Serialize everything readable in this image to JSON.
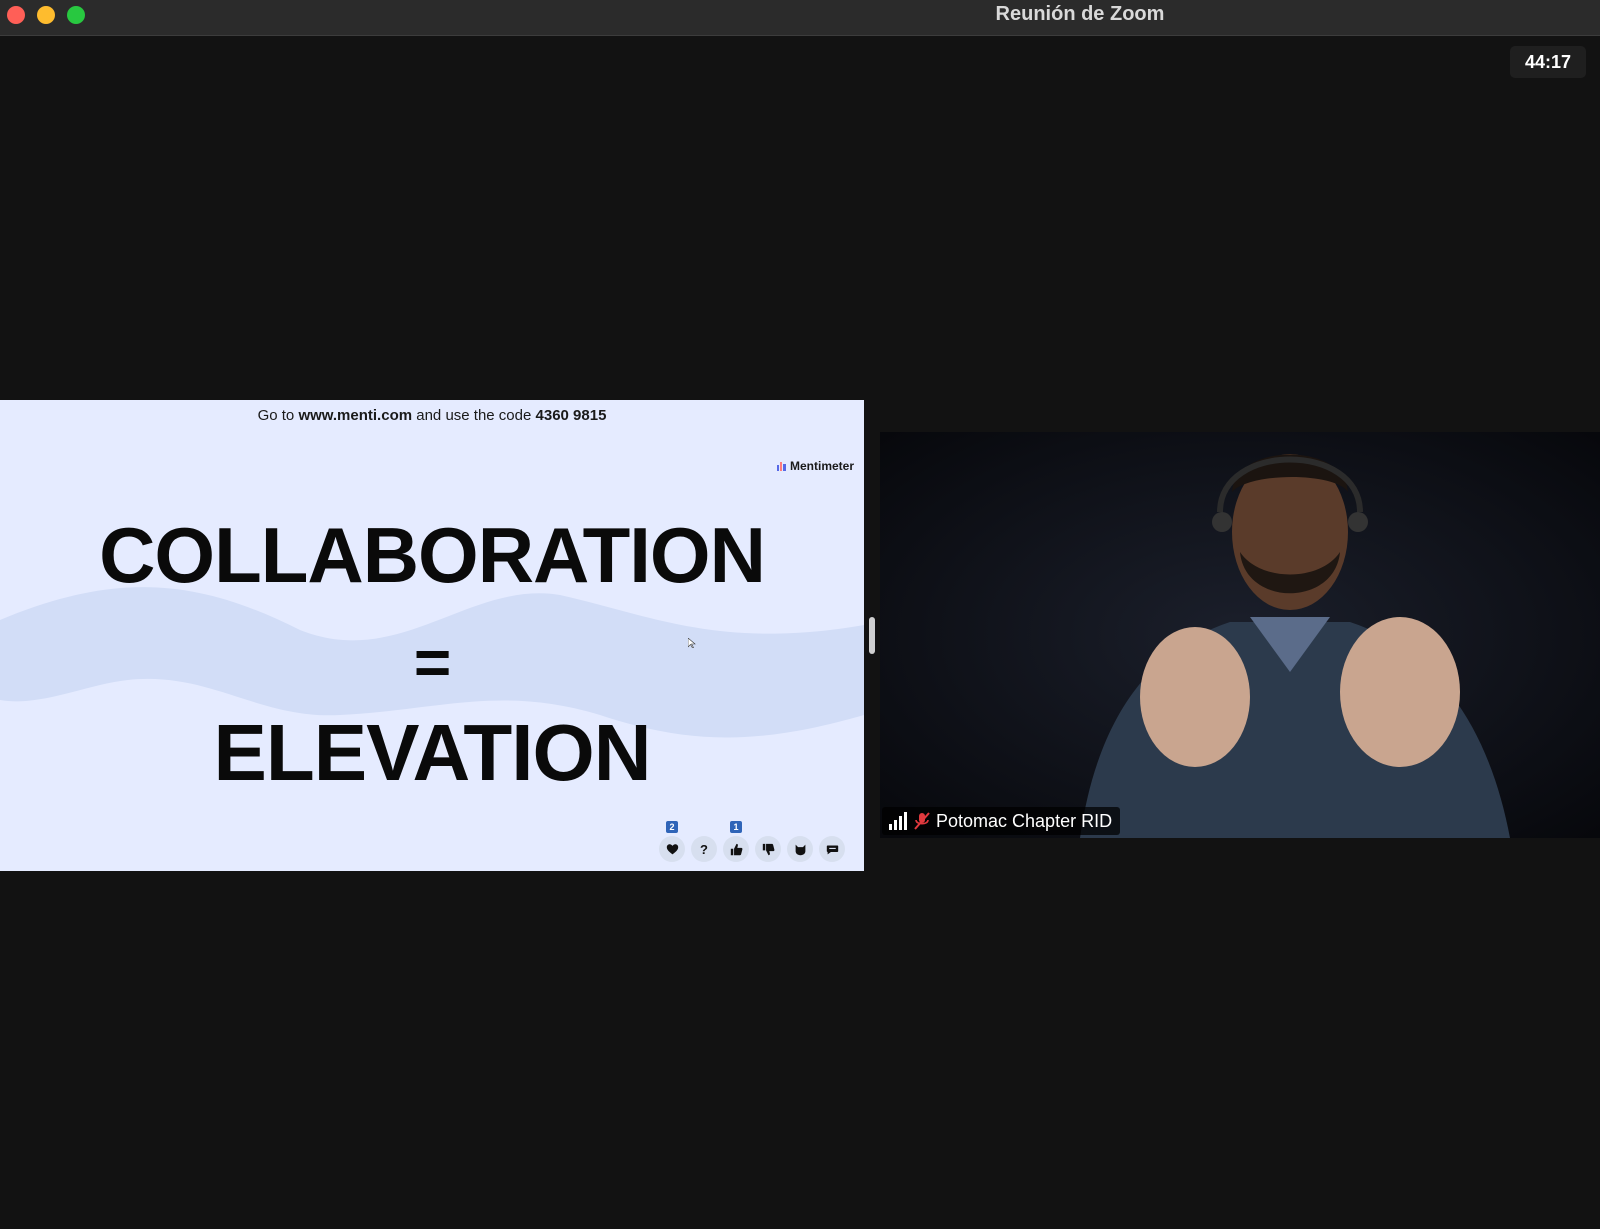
{
  "window": {
    "title": "Reunión de Zoom",
    "timer": "44:17",
    "traffic_colors": {
      "close": "#ff5f57",
      "minimize": "#febc2e",
      "maximize": "#28c840"
    }
  },
  "slide": {
    "instruction_prefix": "Go to ",
    "instruction_url": "www.menti.com",
    "instruction_middle": " and use the code ",
    "instruction_code": "4360 9815",
    "brand": "Mentimeter",
    "line1": "COLLABORATION",
    "line2": "=",
    "line3": "ELEVATION",
    "background_color": "#e5ebff",
    "wave_color": "#d2ddf7",
    "reactions": [
      {
        "icon": "heart-icon",
        "count": "2"
      },
      {
        "icon": "question-icon",
        "glyph": "?"
      },
      {
        "icon": "thumbs-up-icon",
        "count": "1"
      },
      {
        "icon": "thumbs-down-icon"
      },
      {
        "icon": "cat-icon"
      },
      {
        "icon": "comment-icon"
      }
    ]
  },
  "participant": {
    "name": "Potomac Chapter RID",
    "muted": true,
    "mute_color": "#e0393e"
  }
}
